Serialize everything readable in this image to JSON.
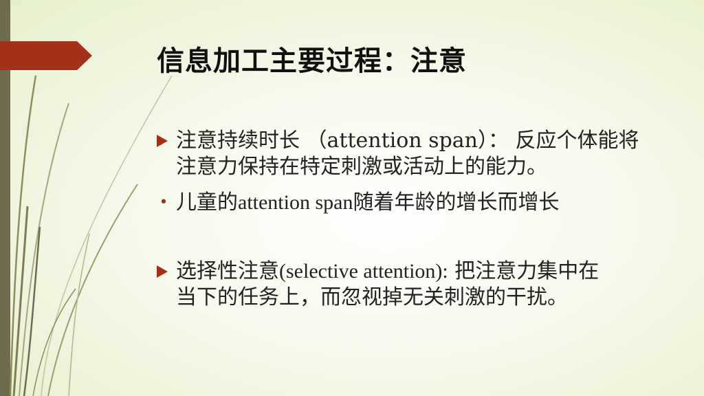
{
  "slide": {
    "title": "信息加工主要过程：注意",
    "bullets": [
      {
        "style": "arrow",
        "line1": "注意持续时长 （attention span）： 反应个体能将",
        "line2": "注意力保持在特定刺激或活动上的能力。"
      },
      {
        "style": "dot",
        "symbol": "•",
        "text_a": "儿童的",
        "text_latin": "attention span",
        "text_b": "随着年龄的增长而增长"
      },
      {
        "style": "arrow",
        "line1_a": "选择性注意",
        "line1_latin": "(selective attention):",
        "line1_b": " 把注意力集中在",
        "line2": "当下的任务上，而忽视掉无关刺激的干扰。"
      }
    ]
  },
  "colors": {
    "accent": "#a5301a",
    "left_bar": "#6e6b4f",
    "decor_lines": "#9a9a68",
    "background_light": "#f6f9ec"
  }
}
